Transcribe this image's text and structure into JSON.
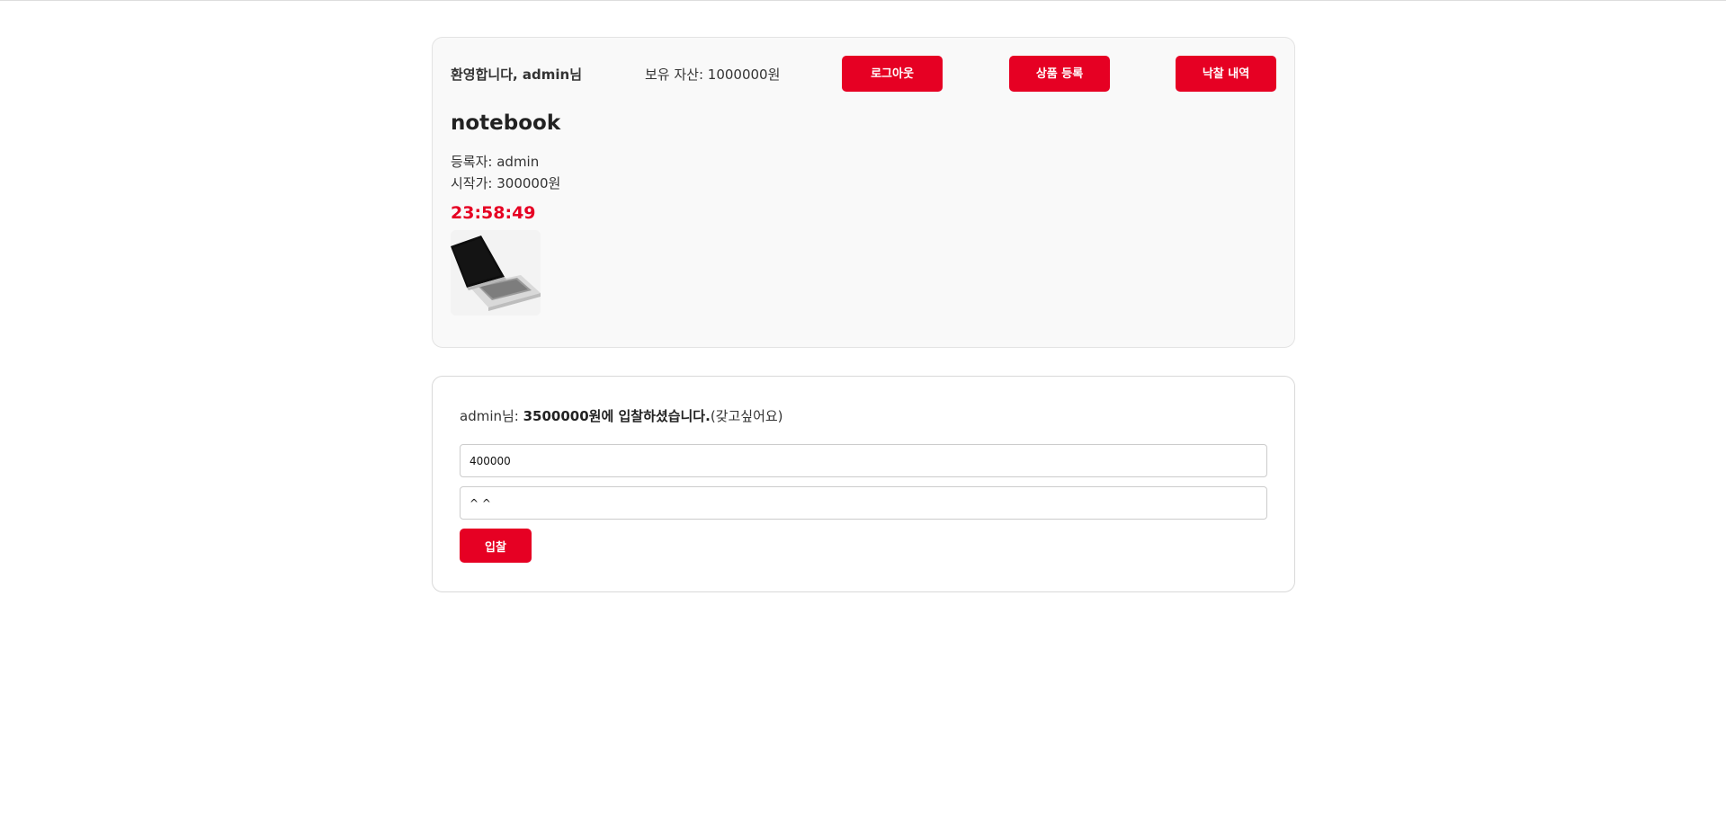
{
  "header": {
    "welcome_prefix": "환영합니다, ",
    "user": "admin",
    "welcome_suffix": "님",
    "assets_label": "보유 자산: ",
    "assets_value": "1000000원",
    "logout_label": "로그아웃",
    "register_label": "상품 등록",
    "history_label": "낙찰 내역"
  },
  "product": {
    "title": "notebook",
    "seller_label": "등록자: ",
    "seller": "admin",
    "start_price_label": "시작가: ",
    "start_price": "300000원",
    "timer": "23:58:49",
    "image_icon": "laptop-image"
  },
  "bid": {
    "user_line": "admin님: ",
    "amount_text": "3500000원에 입찰하셨습니다.",
    "comment": "(갖고싶어요)",
    "amount_input_value": "400000",
    "message_input_value": "^ ^",
    "submit_label": "입찰"
  },
  "colors": {
    "accent": "#e60023",
    "card_bg": "#f9f9f9"
  }
}
